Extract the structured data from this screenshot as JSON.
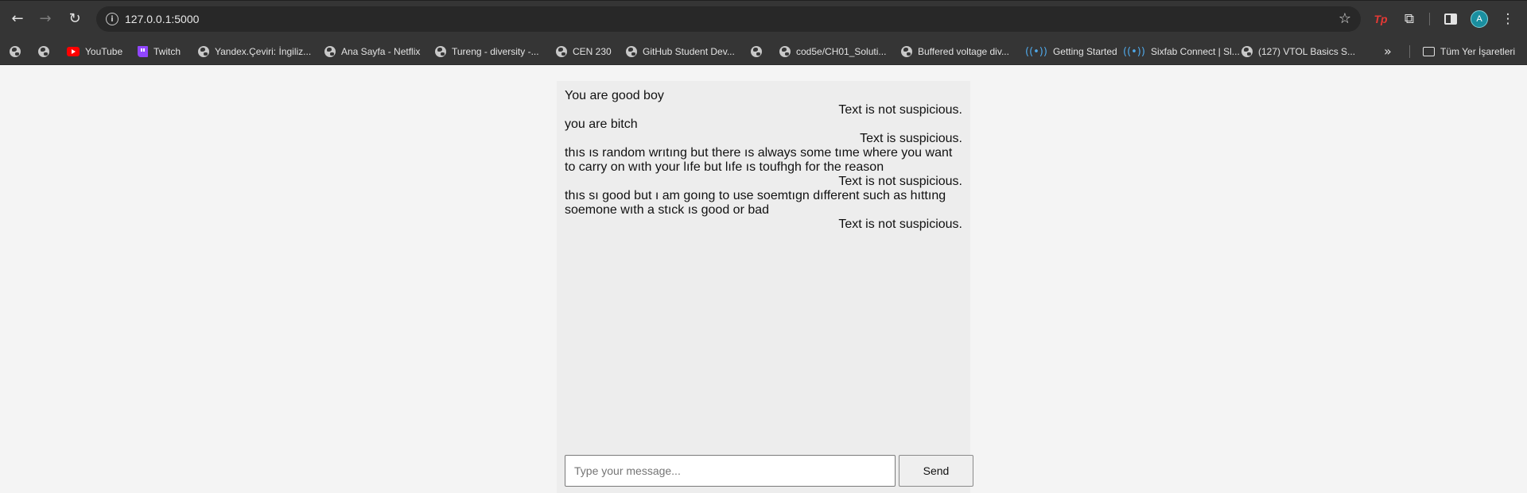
{
  "browser": {
    "url": "127.0.0.1:5000",
    "bookmarks": [
      {
        "label": "",
        "icon": "globe-icon"
      },
      {
        "label": "",
        "icon": "globe-icon"
      },
      {
        "label": "YouTube",
        "icon": "youtube-icon"
      },
      {
        "label": "Twitch",
        "icon": "twitch-icon"
      },
      {
        "label": "Yandex.Çeviri: İngiliz...",
        "icon": "globe-icon"
      },
      {
        "label": "Ana Sayfa - Netflix",
        "icon": "globe-icon"
      },
      {
        "label": "Tureng - diversity -...",
        "icon": "globe-icon"
      },
      {
        "label": "CEN 230",
        "icon": "globe-icon"
      },
      {
        "label": "GitHub Student Dev...",
        "icon": "globe-icon"
      },
      {
        "label": "",
        "icon": "globe-icon"
      },
      {
        "label": "cod5e/CH01_Soluti...",
        "icon": "globe-icon"
      },
      {
        "label": "Buffered voltage div...",
        "icon": "globe-icon"
      },
      {
        "label": "Getting Started",
        "icon": "broadcast-icon"
      },
      {
        "label": "Sixfab Connect | Sl...",
        "icon": "broadcast-icon"
      },
      {
        "label": "(127) VTOL Basics S...",
        "icon": "globe-icon"
      }
    ],
    "all_bookmarks_label": "Tüm Yer İşaretleri",
    "profile_initial": "A",
    "extension_tp_label": "Tp"
  },
  "chat": {
    "messages": [
      {
        "role": "user",
        "text": "You are good boy"
      },
      {
        "role": "bot",
        "text": "Text is not suspicious."
      },
      {
        "role": "user",
        "text": "you are bitch"
      },
      {
        "role": "bot",
        "text": "Text is suspicious."
      },
      {
        "role": "user",
        "text": "thıs ıs random wrıtıng but there ıs always some tıme where you want to carry on wıth your lıfe but lıfe ıs toufhgh for the reason"
      },
      {
        "role": "bot",
        "text": "Text is not suspicious."
      },
      {
        "role": "user",
        "text": "thıs sı good but ı am goıng to use soemtıgn dıfferent such as hıttıng soemone wıth a stıck ıs good or bad"
      },
      {
        "role": "bot",
        "text": "Text is not suspicious."
      }
    ],
    "input_placeholder": "Type your message...",
    "input_value": "",
    "send_label": "Send"
  }
}
